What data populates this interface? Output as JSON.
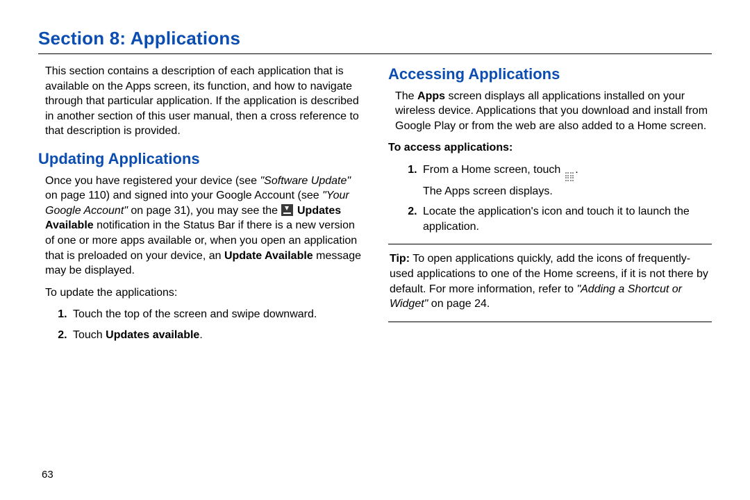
{
  "section_title": "Section 8: Applications",
  "page_number": "63",
  "left": {
    "intro": "This section contains a description of each application that is available on the Apps screen, its function, and how to navigate through that particular application. If the application is described in another section of this user manual, then a cross reference to that description is provided.",
    "heading_updating": "Updating Applications",
    "updating_p1_a": "Once you have registered your device (see ",
    "updating_p1_ref1": "\"Software Update\"",
    "updating_p1_b": " on page 110) and signed into your Google Account (see ",
    "updating_p1_ref2": "\"Your Google Account\"",
    "updating_p1_c": " on page 31), you may see the ",
    "updating_p1_bold1": "Updates Available",
    "updating_p1_d": " notification in the Status Bar if there is a new version of one or more apps available or, when you open an application that is preloaded on your device, an ",
    "updating_p1_bold2": "Update Available",
    "updating_p1_e": " message may be displayed.",
    "to_update": "To update the applications:",
    "step1": "Touch the top of the screen and swipe downward.",
    "step2_a": "Touch ",
    "step2_b": "Updates available",
    "step2_c": "."
  },
  "right": {
    "heading_access": "Accessing Applications",
    "access_p1_a": "The ",
    "access_p1_bold": "Apps",
    "access_p1_b": " screen displays all applications installed on your wireless device. Applications that you download and install from Google Play or from the web are also added to a Home screen.",
    "to_access": "To access applications:",
    "step1_a": "From a Home screen, touch ",
    "step1_b": ".",
    "step1_sub": "The Apps screen displays.",
    "step2": "Locate the application's icon and touch it to launch the application.",
    "tip_label": "Tip:",
    "tip_a": " To open applications quickly, add the icons of frequently-used applications to one of the Home screens, if it is not there by default. For more information, refer to ",
    "tip_ref": "\"Adding a Shortcut or Widget\"",
    "tip_b": " on page 24."
  }
}
